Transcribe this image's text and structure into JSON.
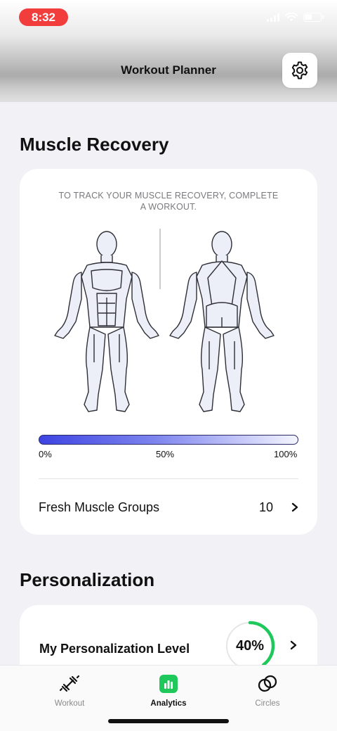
{
  "status": {
    "time": "8:32"
  },
  "header": {
    "title": "Workout Planner",
    "settings_icon": "gear-icon"
  },
  "recovery": {
    "section_title": "Muscle Recovery",
    "hint": "TO TRACK YOUR MUSCLE RECOVERY, COMPLETE A WORKOUT.",
    "scale": {
      "min": "0%",
      "mid": "50%",
      "max": "100%"
    },
    "fresh_label": "Fresh Muscle Groups",
    "fresh_count": "10",
    "gradient_colors": [
      "#3d44e2",
      "#f4f5ff"
    ]
  },
  "personalization": {
    "section_title": "Personalization",
    "label": "My Personalization Level",
    "level_text": "40%",
    "level_value": 0.4,
    "ring_color": "#1fc85a"
  },
  "tabs": [
    {
      "label": "Workout",
      "icon": "dumbbell-icon",
      "active": false
    },
    {
      "label": "Analytics",
      "icon": "analytics-icon",
      "active": true
    },
    {
      "label": "Circles",
      "icon": "circles-icon",
      "active": false
    }
  ],
  "accent": "#1fc85a"
}
